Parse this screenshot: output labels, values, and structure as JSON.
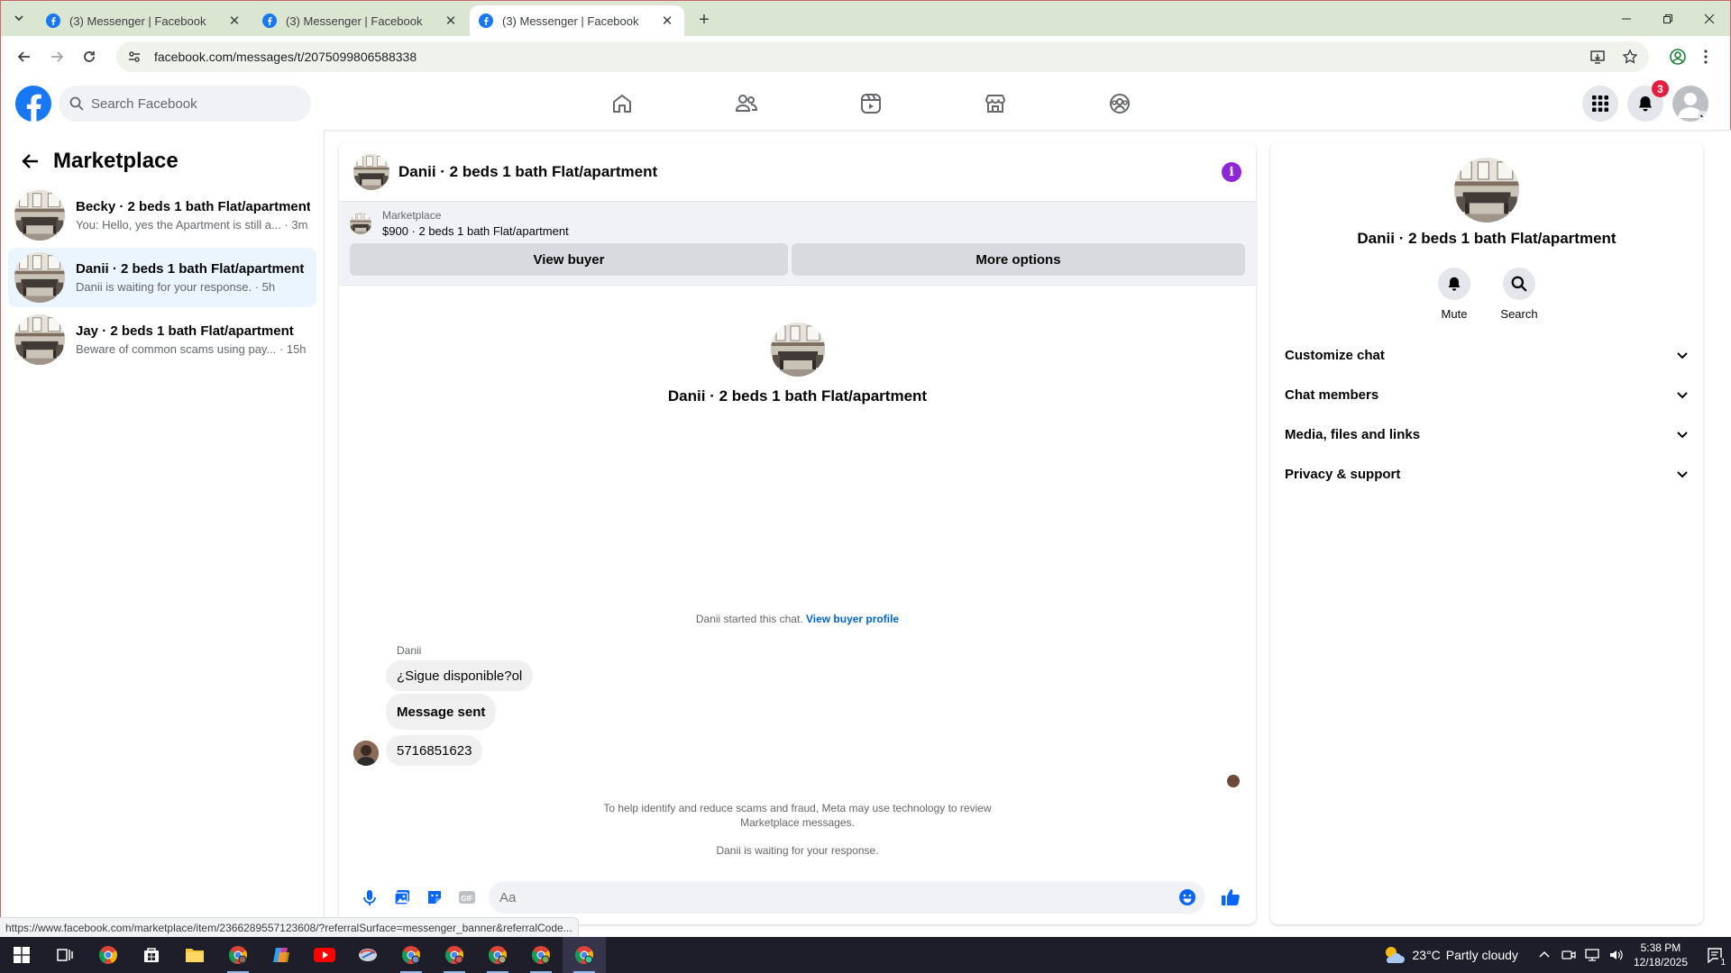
{
  "browser": {
    "tabs": [
      {
        "title": "(3) Messenger | Facebook",
        "active": false
      },
      {
        "title": "(3) Messenger | Facebook",
        "active": false
      },
      {
        "title": "(3) Messenger | Facebook",
        "active": true
      }
    ],
    "url": "facebook.com/messages/t/2075099806588338"
  },
  "header": {
    "search_placeholder": "Search Facebook",
    "notifications_count": "3"
  },
  "sidebar": {
    "title": "Marketplace",
    "conversations": [
      {
        "name": "Becky · 2 beds 1 bath Flat/apartment",
        "preview": "You: Hello, yes the Apartment is still a... · 3m",
        "active": false
      },
      {
        "name": "Danii · 2 beds 1 bath Flat/apartment",
        "preview": "Danii is waiting for your response. · 5h",
        "active": true
      },
      {
        "name": "Jay · 2 beds 1 bath Flat/apartment",
        "preview": "Beware of common scams using pay... · 15h",
        "active": false
      }
    ]
  },
  "chat": {
    "title": "Danii · 2 beds 1 bath Flat/apartment",
    "marketplace_label": "Marketplace",
    "listing_detail": "$900 · 2 beds 1 bath Flat/apartment",
    "view_buyer": "View buyer",
    "more_options": "More options",
    "intro_name": "Danii · 2 beds 1 bath Flat/apartment",
    "started_text": "Danii started this chat.",
    "view_buyer_profile": "View buyer profile",
    "sender": "Danii",
    "messages": [
      {
        "text": "¿Sigue disponible?ol",
        "bold": false
      },
      {
        "text": "Message sent",
        "bold": true
      },
      {
        "text": "5716851623",
        "bold": false
      }
    ],
    "scam_notice_line1": "To help identify and reduce scams and fraud, Meta may use technology to review",
    "scam_notice_line2": "Marketplace messages.",
    "waiting_notice": "Danii is waiting for your response.",
    "composer_placeholder": "Aa"
  },
  "info_panel": {
    "name": "Danii · 2 beds 1 bath Flat/apartment",
    "mute_label": "Mute",
    "search_label": "Search",
    "sections": [
      "Customize chat",
      "Chat members",
      "Media, files and links",
      "Privacy & support"
    ]
  },
  "status_url": "https://www.facebook.com/marketplace/item/2366289557123608/?referralSurface=messenger_banner&referralCode...",
  "taskbar": {
    "weather_temp": "23°C",
    "weather_desc": "Partly cloudy",
    "time": "5:38 PM",
    "date": "12/18/2025",
    "notif_count": "1"
  },
  "colors": {
    "fb_blue": "#1877f2",
    "active_conv": "#ebf5ff",
    "badge_red": "#e41e3f",
    "info_purple": "#8f26d6",
    "link_blue": "#0064d1"
  }
}
